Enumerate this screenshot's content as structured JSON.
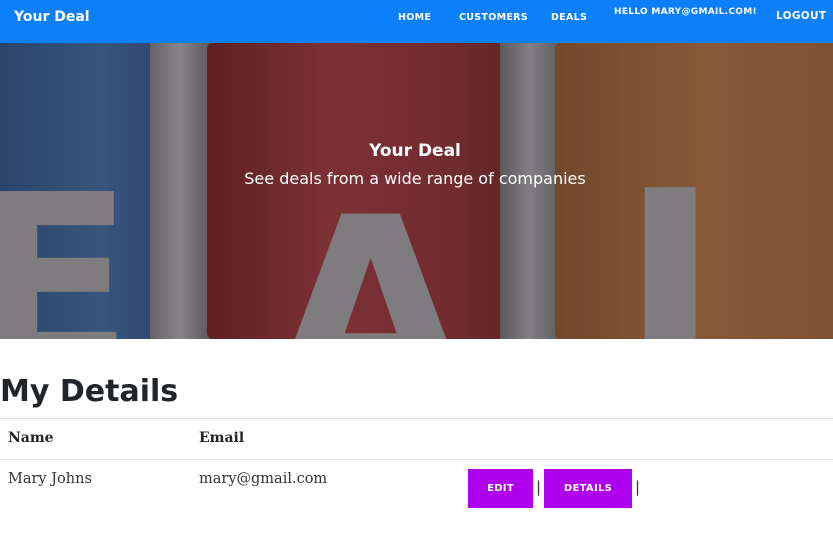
{
  "navbar": {
    "brand": "Your Deal",
    "links": {
      "home": "HOME",
      "customers": "CUSTOMERS",
      "deals": "DEALS"
    },
    "greeting": "HELLO MARY@GMAIL.COM!",
    "logout": "LOGOUT",
    "background_color": "#0c7ffb"
  },
  "hero": {
    "title": "Your Deal",
    "subtitle": "See deals from a wide range of companies"
  },
  "details": {
    "heading": "My Details",
    "columns": {
      "name": "Name",
      "email": "Email"
    },
    "row": {
      "name": "Mary Johns",
      "email": "mary@gmail.com",
      "separator": "|"
    },
    "actions": {
      "edit": "EDIT",
      "details": "DETAILS",
      "button_color": "#b000f0"
    }
  }
}
